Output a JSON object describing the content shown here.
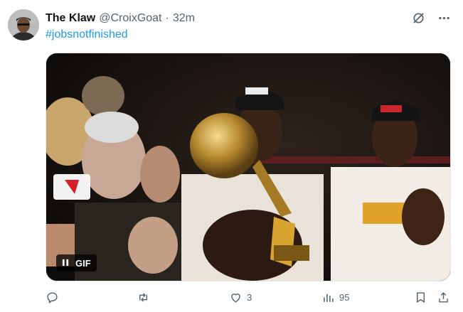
{
  "tweet": {
    "display_name": "The Klaw",
    "handle": "@CroixGoat",
    "separator": "·",
    "time": "32m",
    "text": "#jobsnotfinished",
    "media": {
      "badge_label": "GIF"
    }
  },
  "icons": {
    "more": "more-icon",
    "grok": "grok-icon",
    "pause": "pause-icon",
    "reply": "reply-icon",
    "retweet": "retweet-icon",
    "like": "heart-icon",
    "views": "views-icon",
    "bookmark": "bookmark-icon",
    "share": "share-icon"
  },
  "actions": {
    "reply_count": "",
    "retweet_count": "",
    "like_count": "3",
    "view_count": "95"
  },
  "colors": {
    "link": "#1d9bf0",
    "muted": "#536471",
    "text": "#0f1419"
  }
}
